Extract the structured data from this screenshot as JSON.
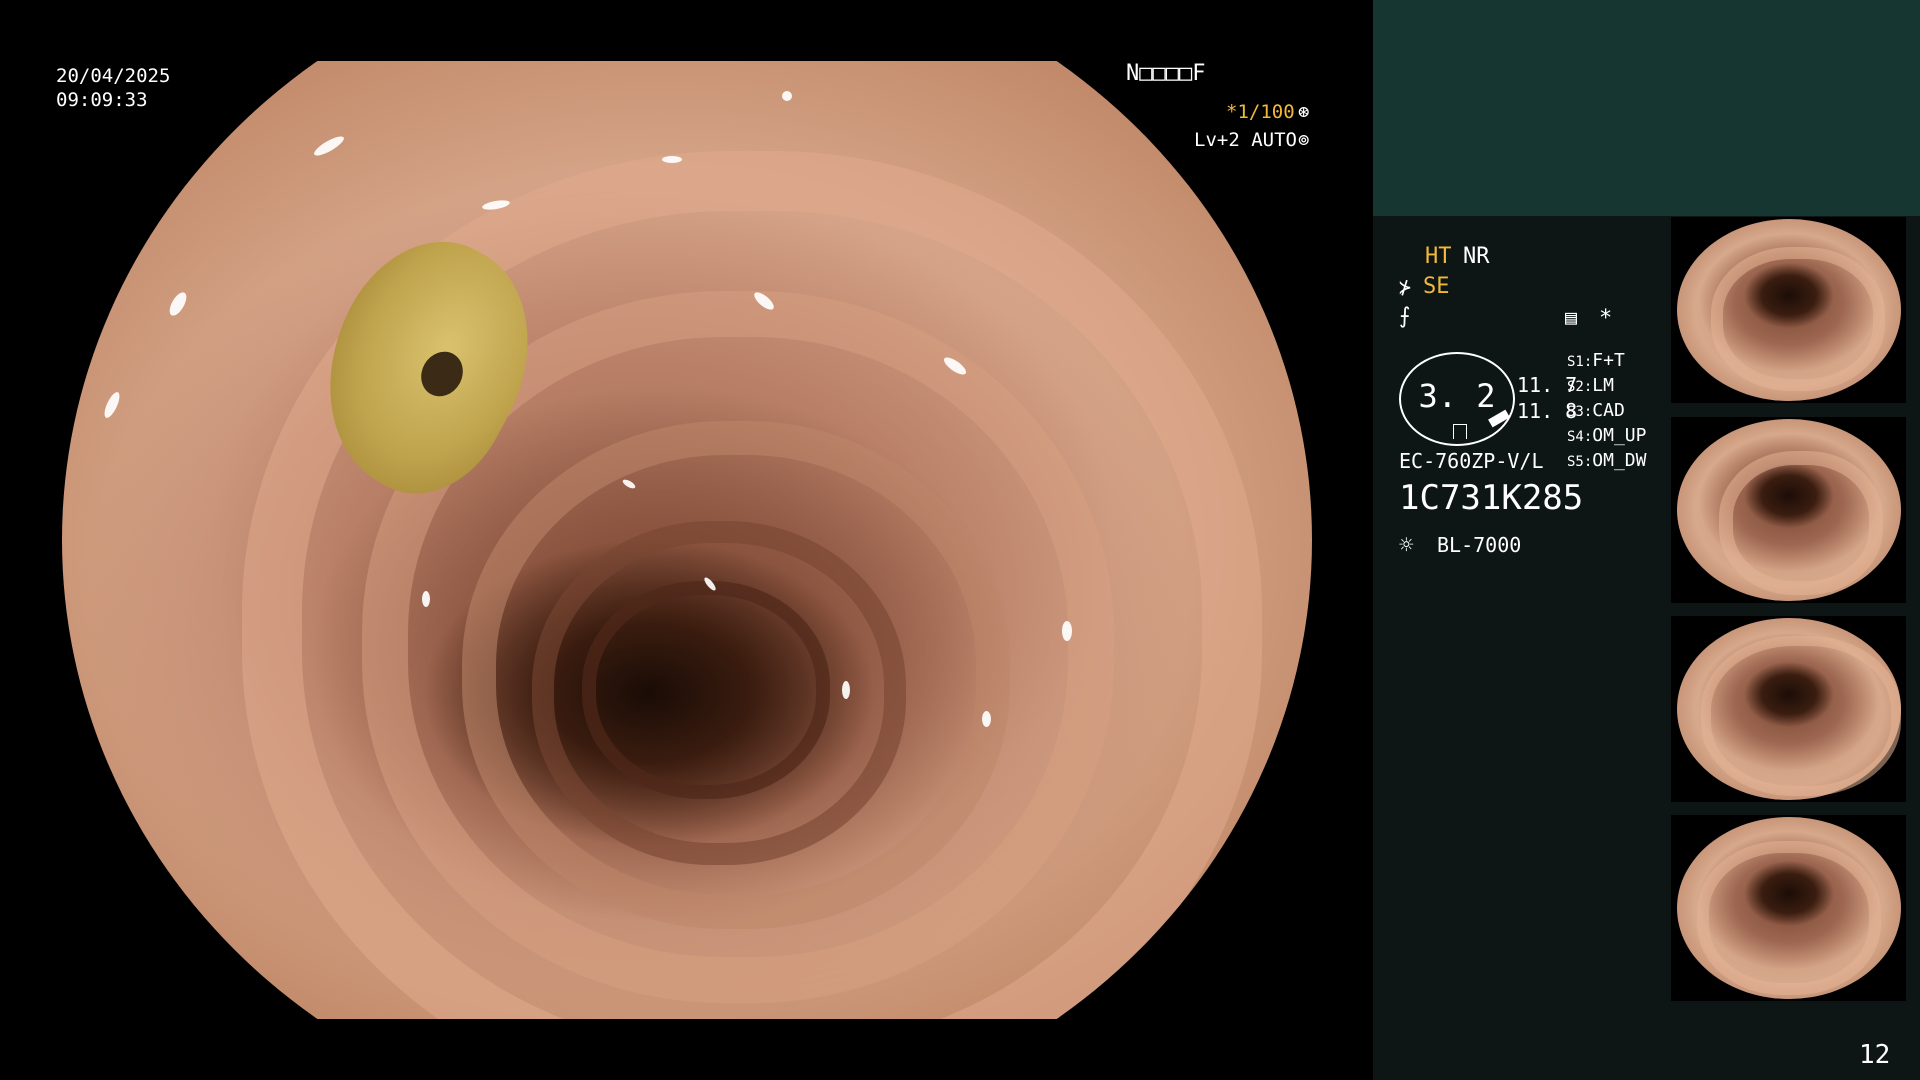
{
  "video": {
    "date": "20/04/2025",
    "time": "09:09:33",
    "patient_id": "N□□□□F",
    "shutter": "*1/100",
    "shutter_icon": "⊛",
    "level": "Lv+2 AUTO",
    "level_icon": "⊚"
  },
  "panel": {
    "ht": "HT",
    "nr": "NR",
    "se_icon": "⊁",
    "se": "SE",
    "f_icon": "⨍",
    "doc_icon": "▤",
    "star": "*",
    "dial_value": "3. 2",
    "values": [
      "11. 7",
      "11. 8"
    ],
    "slots": [
      {
        "num": "S1:",
        "label": "F+T"
      },
      {
        "num": "S2:",
        "label": "LM"
      },
      {
        "num": "S3:",
        "label": "CAD"
      },
      {
        "num": "S4:",
        "label": "OM_UP"
      },
      {
        "num": "S5:",
        "label": "OM_DW"
      }
    ],
    "scope_model": "EC-760ZP-V/L",
    "scope_serial": "1C731K285",
    "light_icon": "☼",
    "light_source": "BL-7000",
    "image_count": "12"
  },
  "colors": {
    "accent_yellow": "#f0b93b",
    "panel_bg": "#0e1615",
    "panel_top": "#163632"
  }
}
